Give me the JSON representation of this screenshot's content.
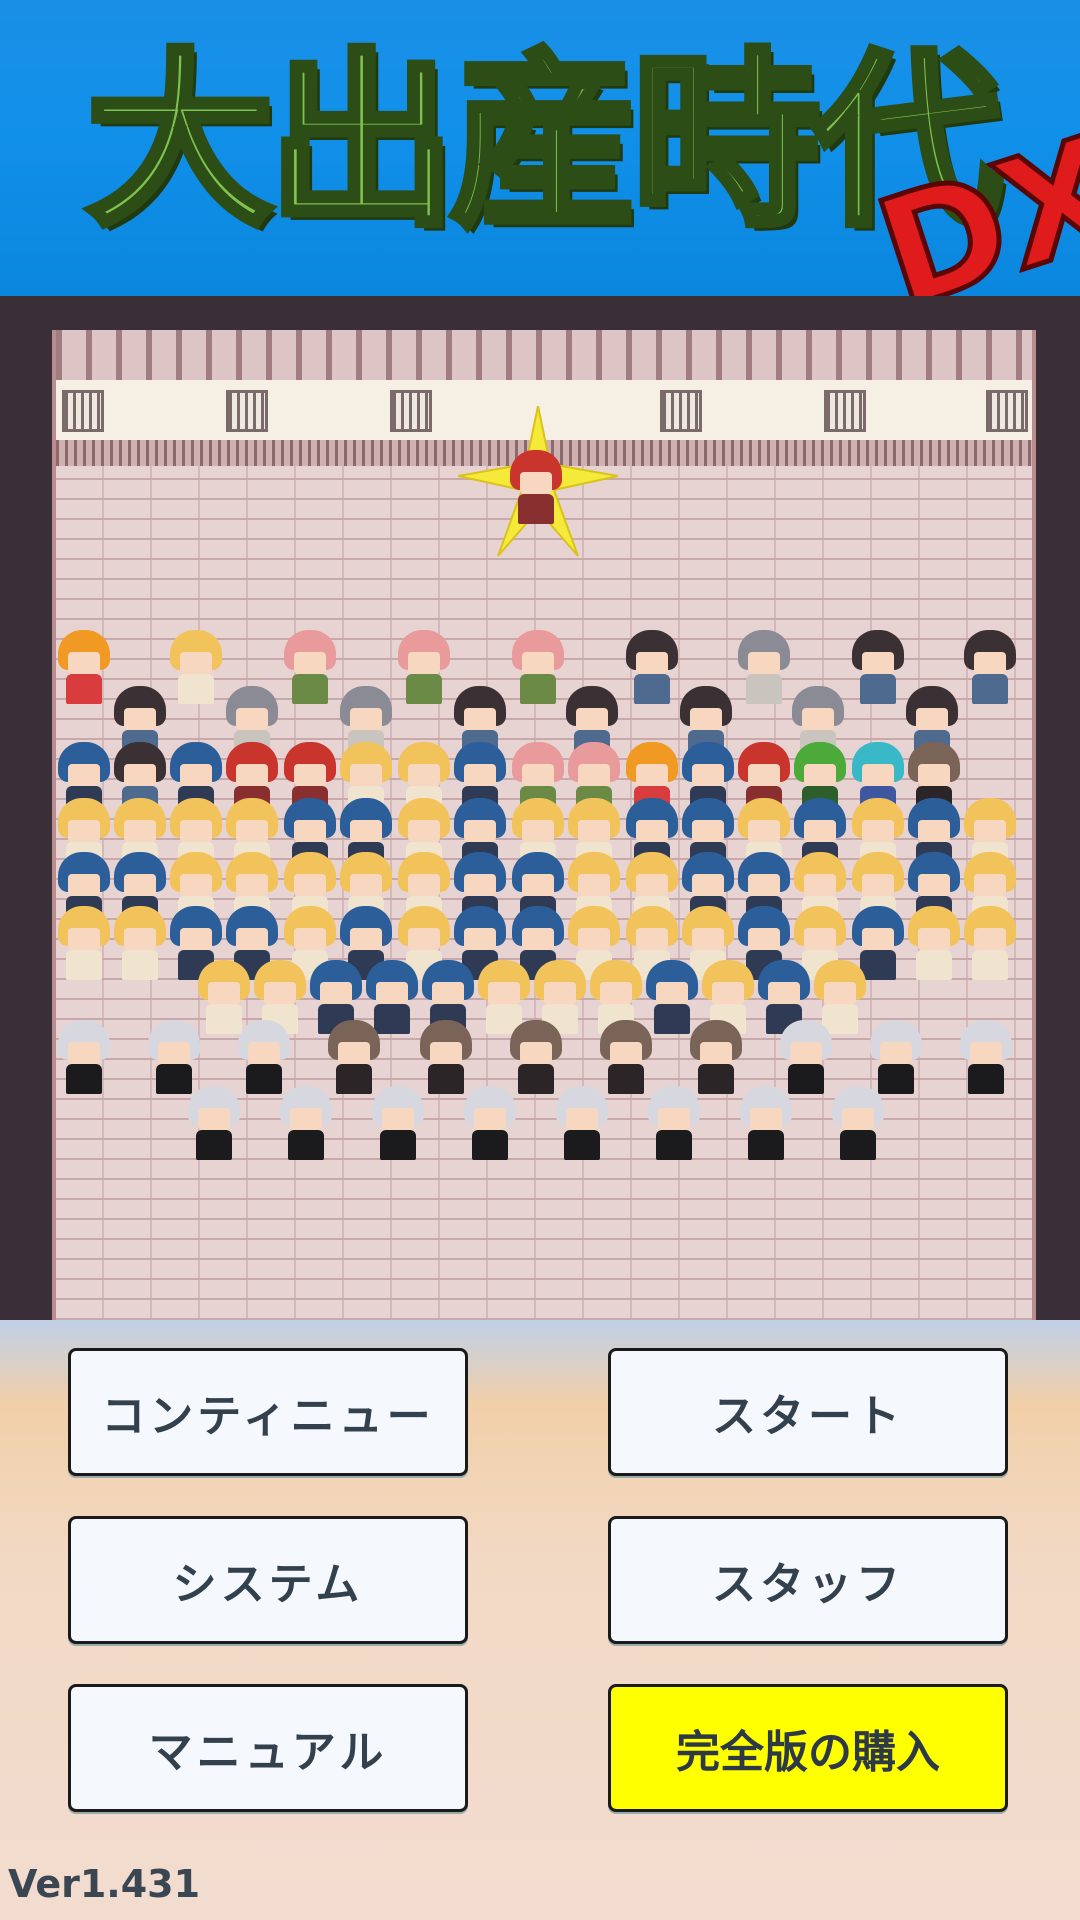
{
  "title": {
    "main": "大出産時代",
    "suffix": "DX"
  },
  "menu": {
    "continue_label": "コンティニュー",
    "start_label": "スタート",
    "system_label": "システム",
    "staff_label": "スタッフ",
    "manual_label": "マニュアル",
    "purchase_label": "完全版の購入"
  },
  "version": "Ver1.431",
  "colors": {
    "banner_blue": "#1190ea",
    "title_green": "#7fc24f",
    "dx_red": "#e01b1b",
    "purchase_yellow": "#ffff00",
    "button_white": "#f5f9fd"
  },
  "icons": {
    "highlight": "star-burst-icon"
  }
}
